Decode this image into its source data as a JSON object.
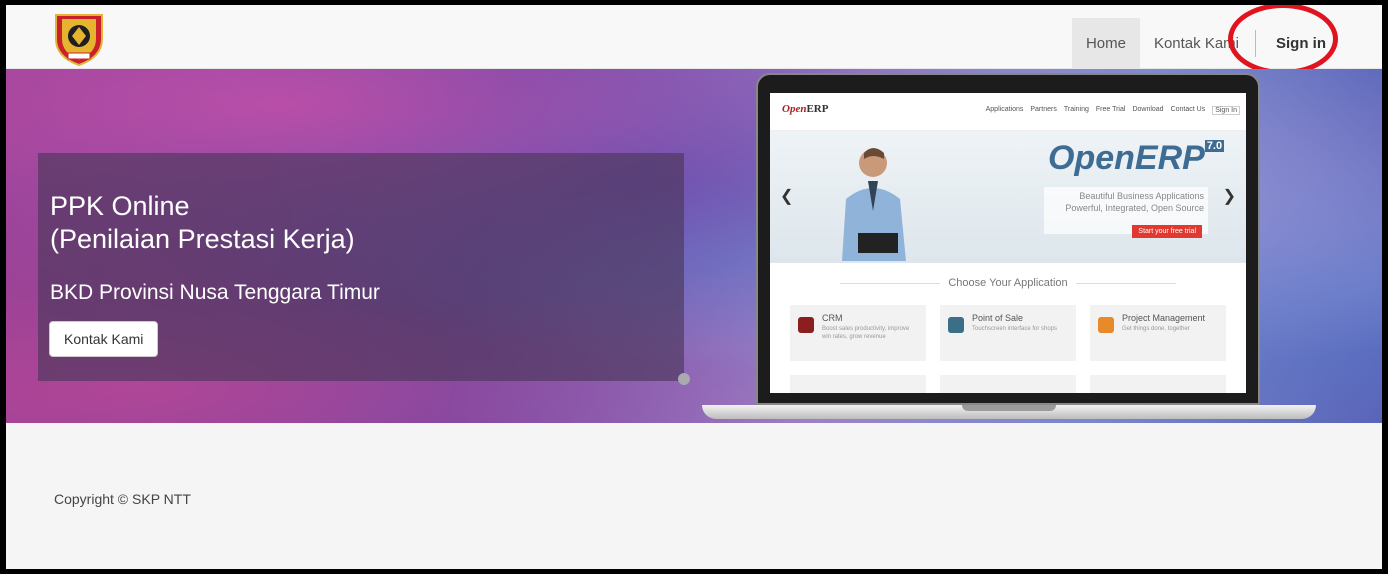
{
  "header": {
    "logo_name": "provincial-crest",
    "nav": {
      "home": "Home",
      "contact": "Kontak Kami",
      "signin": "Sign in"
    },
    "highlight_color": "#e0141e"
  },
  "hero": {
    "title_line1": "PPK Online",
    "title_line2": "(Penilaian Prestasi Kerja)",
    "subtitle": "BKD Provinsi Nusa Tenggara Timur",
    "button_label": "Kontak Kami"
  },
  "laptop_screen": {
    "logo_prefix": "Open",
    "logo_suffix": "ERP",
    "nav_links": [
      "Applications",
      "Partners",
      "Training",
      "Free Trial",
      "Download",
      "Contact Us",
      "Sign In"
    ],
    "product_title": "OpenERP",
    "product_version": "7.0",
    "tagline_1": "Beautiful Business Applications",
    "tagline_2": "Powerful, Integrated, Open Source",
    "cta": "Start your free trial",
    "section_title": "Choose Your Application",
    "cards": [
      {
        "title": "CRM",
        "desc": "Boost sales productivity, improve win rates, grow revenue",
        "color": "#8b1f1f"
      },
      {
        "title": "Point of Sale",
        "desc": "Touchscreen interface for shops",
        "color": "#3b6f88"
      },
      {
        "title": "Project Management",
        "desc": "Get things done, together",
        "color": "#e88a2a"
      }
    ]
  },
  "footer": {
    "copyright": "Copyright © SKP NTT"
  }
}
